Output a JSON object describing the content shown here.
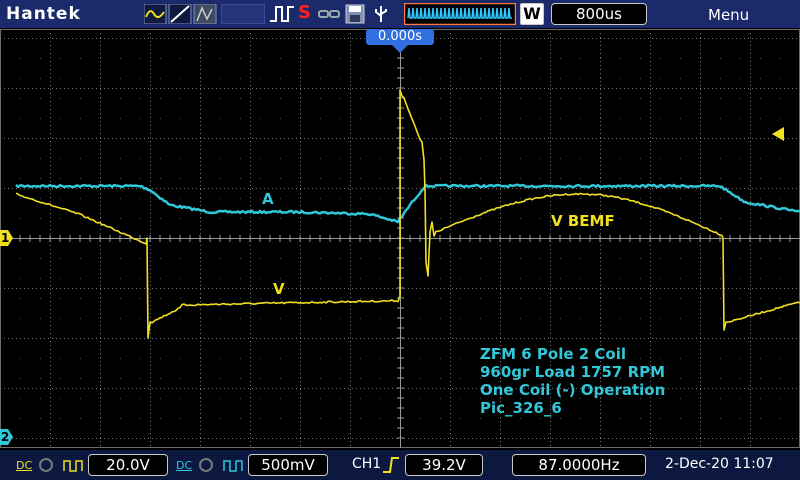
{
  "header": {
    "brand": "Hantek",
    "stop_indicator": "S",
    "timebase": "800us",
    "trigger_mode": "W",
    "menu_label": "Menu"
  },
  "screen": {
    "trigger_time_marker": "0.000s",
    "ch1_marker": "1",
    "ch2_marker": "2",
    "trace_labels": {
      "a": "A",
      "v": "V",
      "v_bemf": "V BEMF"
    },
    "note_lines": [
      "ZFM 6 Pole 2 Coil",
      "960gr Load 1757 RPM",
      "One Coil (-) Operation",
      "Pic_326_6"
    ]
  },
  "footer": {
    "ch1_coupling": "DC",
    "ch1_volts_div": "20.0V",
    "ch2_coupling": "DC",
    "ch2_volts_div": "500mV",
    "trigger_source": "CH1",
    "trigger_level": "39.2V",
    "frequency": "87.0000Hz",
    "datetime": "2-Dec-20 11:07"
  },
  "colors": {
    "ch1": "#f0e020",
    "ch2": "#30c8d8",
    "grid": "#6a6a6a",
    "accent": "#ff7a3a",
    "trigger_marker": "#3070e0"
  }
}
